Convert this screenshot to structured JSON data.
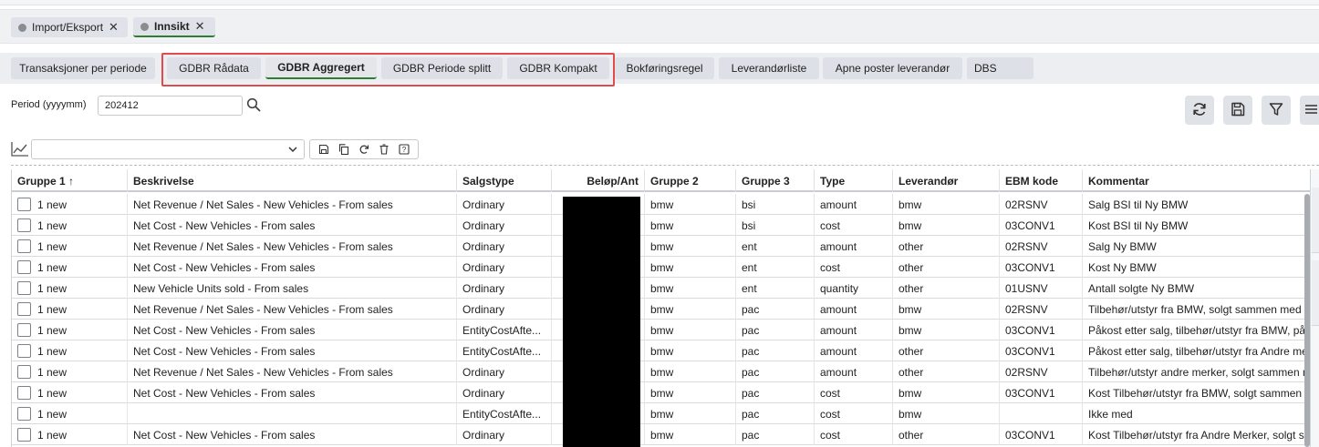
{
  "doc_tabs": [
    {
      "label": "Import/Eksport",
      "close": "✕",
      "active": false
    },
    {
      "label": "Innsikt",
      "close": "✕",
      "active": true
    }
  ],
  "sub_tabs": [
    {
      "label": "Transaksjoner per periode",
      "active": false
    },
    {
      "label": "GDBR Rådata",
      "active": false
    },
    {
      "label": "GDBR Aggregert",
      "active": true
    },
    {
      "label": "GDBR Periode splitt",
      "active": false
    },
    {
      "label": "GDBR Kompakt",
      "active": false
    },
    {
      "label": "Bokføringsregel",
      "active": false
    },
    {
      "label": "Leverandørliste",
      "active": false
    },
    {
      "label": "Apne poster leverandør",
      "active": false
    },
    {
      "label": "DBS",
      "active": false
    }
  ],
  "filter": {
    "period_label": "Period (yyyymm)",
    "period_value": "202412"
  },
  "toolbar_icons": [
    "refresh-icon",
    "save-icon",
    "filter-icon",
    "menu-icon"
  ],
  "view_tools_icons": [
    "save-icon",
    "copy-icon",
    "refresh-icon",
    "delete-icon",
    "help-icon"
  ],
  "grid": {
    "columns": [
      "Gruppe 1 ↑",
      "Beskrivelse",
      "Salgstype",
      "Beløp/Ant",
      "Gruppe 2",
      "Gruppe 3",
      "Type",
      "Leverandør",
      "EBM kode",
      "Kommentar"
    ],
    "rows": [
      [
        "1 new",
        "Net Revenue / Net Sales - New Vehicles - From sales",
        "Ordinary",
        "",
        "bmw",
        "bsi",
        "amount",
        "bmw",
        "02RSNV",
        "Salg BSI til Ny BMW"
      ],
      [
        "1 new",
        "Net Cost - New Vehicles - From sales",
        "Ordinary",
        "",
        "bmw",
        "bsi",
        "cost",
        "bmw",
        "03CONV1",
        "Kost BSI til Ny BMW"
      ],
      [
        "1 new",
        "Net Revenue / Net Sales - New Vehicles - From sales",
        "Ordinary",
        "",
        "bmw",
        "ent",
        "amount",
        "other",
        "02RSNV",
        "Salg Ny BMW"
      ],
      [
        "1 new",
        "Net Cost - New Vehicles - From sales",
        "Ordinary",
        "",
        "bmw",
        "ent",
        "cost",
        "other",
        "03CONV1",
        "Kost Ny BMW"
      ],
      [
        "1 new",
        "New Vehicle Units sold - From sales",
        "Ordinary",
        "",
        "bmw",
        "ent",
        "quantity",
        "other",
        "01USNV",
        "Antall solgte Ny BMW"
      ],
      [
        "1 new",
        "Net Revenue / Net Sales - New Vehicles - From sales",
        "Ordinary",
        "",
        "bmw",
        "pac",
        "amount",
        "bmw",
        "02RSNV",
        "Tilbehør/utstyr fra BMW, solgt sammen med"
      ],
      [
        "1 new",
        "Net Cost - New Vehicles - From sales",
        "EntityCostAfte...",
        "",
        "bmw",
        "pac",
        "amount",
        "bmw",
        "03CONV1",
        "Påkost etter salg, tilbehør/utstyr fra BMW, på"
      ],
      [
        "1 new",
        "Net Cost - New Vehicles - From sales",
        "EntityCostAfte...",
        "",
        "bmw",
        "pac",
        "amount",
        "other",
        "03CONV1",
        "Påkost etter salg, tilbehør/utstyr fra Andre me"
      ],
      [
        "1 new",
        "Net Revenue / Net Sales - New Vehicles - From sales",
        "Ordinary",
        "",
        "bmw",
        "pac",
        "amount",
        "other",
        "02RSNV",
        "Tilbehør/utstyr andre merker, solgt sammen m"
      ],
      [
        "1 new",
        "Net Cost - New Vehicles - From sales",
        "Ordinary",
        "",
        "bmw",
        "pac",
        "cost",
        "bmw",
        "03CONV1",
        "Kost Tilbehør/utstyr fra BMW, solgt sammen"
      ],
      [
        "1 new",
        "",
        "EntityCostAfte...",
        "",
        "bmw",
        "pac",
        "cost",
        "bmw",
        "",
        "Ikke med"
      ],
      [
        "1 new",
        "Net Cost - New Vehicles - From sales",
        "Ordinary",
        "",
        "bmw",
        "pac",
        "cost",
        "other",
        "03CONV1",
        "Kost Tilbehør/utstyr fra Andre Merker, solgt s"
      ]
    ]
  }
}
